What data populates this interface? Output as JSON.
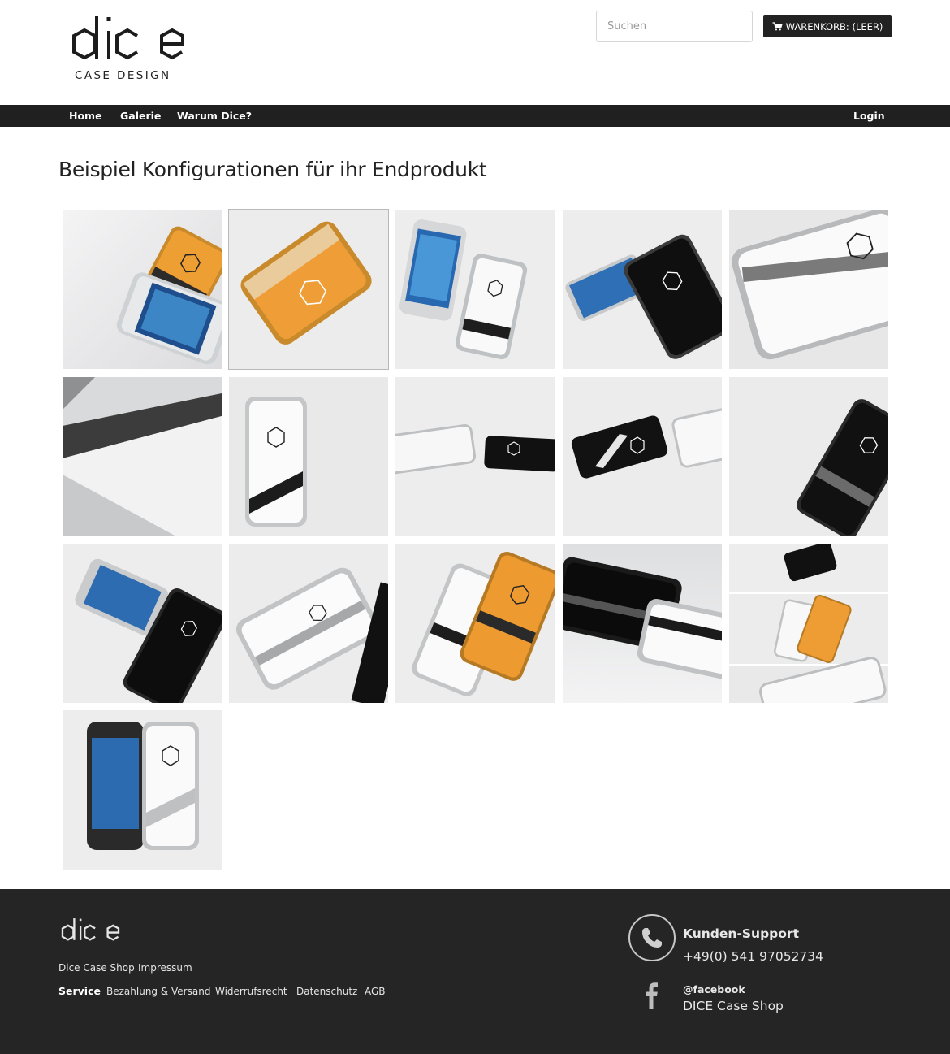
{
  "brand": {
    "logo_text": "dice",
    "logo_subtitle": "CASE DESIGN"
  },
  "header": {
    "search_placeholder": "Suchen",
    "cart_label": "WARENKORB: (LEER)",
    "cart_icon": "shopping-cart-icon"
  },
  "nav": {
    "items": [
      {
        "label": "Home"
      },
      {
        "label": "Galerie"
      },
      {
        "label": "Warum Dice?"
      }
    ],
    "login_label": "Login"
  },
  "main": {
    "title": "Beispiel Konfigurationen für ihr Endprodukt",
    "gallery": [
      {
        "case": "orange"
      },
      {
        "case": "orange"
      },
      {
        "case": "white"
      },
      {
        "case": "black"
      },
      {
        "case": "white"
      },
      {
        "case": "engraving"
      },
      {
        "case": "white"
      },
      {
        "case": "white-black"
      },
      {
        "case": "black-white"
      },
      {
        "case": "black"
      },
      {
        "case": "black"
      },
      {
        "case": "white"
      },
      {
        "case": "white-orange"
      },
      {
        "case": "black-white"
      },
      {
        "case": "collage"
      },
      {
        "case": "white"
      }
    ],
    "selected_index": 1
  },
  "footer": {
    "logo_text": "dice",
    "links_row1": [
      "Dice Case Shop",
      "Impressum"
    ],
    "service_label": "Service",
    "links_row2": [
      "Bezahlung & Versand",
      "Widerrufsrecht",
      "Datenschutz",
      "AGB"
    ],
    "support_title": "Kunden-Support",
    "support_phone": "+49(0) 541 97052734",
    "facebook_handle": "@facebook",
    "facebook_name": "DICE Case Shop"
  },
  "colors": {
    "nav_bg": "#202020",
    "footer_bg": "#252525",
    "case_orange": "#e8962e",
    "case_black": "#141414",
    "case_white": "#f7f7f7"
  }
}
